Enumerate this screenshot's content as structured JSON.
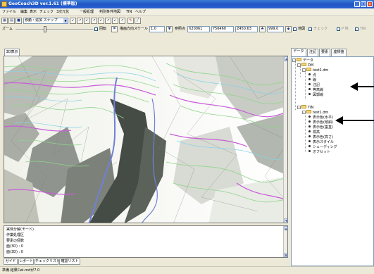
{
  "window": {
    "title": "GeoCoach3D ver.1.61 (標準版)",
    "controls": [
      "_",
      "□",
      "x"
    ]
  },
  "menu": [
    "ファイル",
    "編集",
    "表示",
    "チェック",
    "3次元化",
    "一般処理",
    "判別条件地図",
    "TIN",
    "ヘルプ"
  ],
  "toolbar1": {
    "mode_select": "移動・追加 スナップ",
    "tool_icons": [
      "↙",
      "↗",
      "↙",
      "↗",
      "↙",
      "↗",
      "↙",
      "↗"
    ]
  },
  "toolbar2": {
    "zoom_label": "ズーム",
    "rotate_label": "回転",
    "z_scale_label": "描画方向スケール",
    "z_scale_value": "1.0",
    "origin_label": "参照点",
    "origin_x": "X20061",
    "origin_y": "Y56460",
    "origin_z": "Z450.63",
    "height_value": "999.0",
    "map_label": "地図",
    "check_label": "チェック",
    "pen_label": "P 地",
    "tin_label": "TIN"
  },
  "view_tab": "3D表示",
  "panel_tabs": [
    "データ",
    "注記",
    "要素",
    "座標値"
  ],
  "tree": [
    {
      "level": 0,
      "kind": "folder",
      "label": "データ",
      "expand": "-"
    },
    {
      "level": 1,
      "kind": "folder",
      "label": "DM",
      "expand": "-"
    },
    {
      "level": 2,
      "kind": "folder",
      "label": "test1.dm",
      "expand": "-"
    },
    {
      "level": 3,
      "kind": "item",
      "label": "点"
    },
    {
      "level": 3,
      "kind": "item",
      "label": "線"
    },
    {
      "level": 3,
      "kind": "item",
      "label": "注記"
    },
    {
      "level": 3,
      "kind": "item",
      "label": "等高線"
    },
    {
      "level": 3,
      "kind": "item",
      "label": "図郭線"
    },
    {
      "level": 1,
      "kind": "folder",
      "label": "TIN",
      "expand": "-"
    },
    {
      "level": 2,
      "kind": "folder",
      "label": "test1.dm",
      "expand": "-"
    },
    {
      "level": 3,
      "kind": "item",
      "label": "表示色(水平)"
    },
    {
      "level": 3,
      "kind": "item",
      "label": "表示色(傾斜)"
    },
    {
      "level": 3,
      "kind": "item",
      "label": "表示色(垂直)"
    },
    {
      "level": 3,
      "kind": "item",
      "label": "標高"
    },
    {
      "level": 3,
      "kind": "item",
      "label": "表示色(高さ)"
    },
    {
      "level": 3,
      "kind": "item",
      "label": "表示スタイル"
    },
    {
      "level": 3,
      "kind": "item",
      "label": "シェーディング"
    },
    {
      "level": 3,
      "kind": "item",
      "label": "オフセット"
    }
  ],
  "log_lines": [
    "実体分解(モード)",
    "作業処理区",
    "要素の個数",
    "  面(3D) : 0",
    "  面(3D) : 0"
  ],
  "bottom_tabs": [
    "ガイド",
    "レポート",
    "チェックリスト",
    "確認リスト"
  ],
  "status_text": "準備 結果Cwi.mdが7.0",
  "colors": {
    "titlebar": "#2a5fd0",
    "contour_green": "#7fd07a",
    "contour_magenta": "#c64fd6",
    "contour_cyan": "#7ad0e6",
    "road_blue": "#6c7fd8"
  }
}
